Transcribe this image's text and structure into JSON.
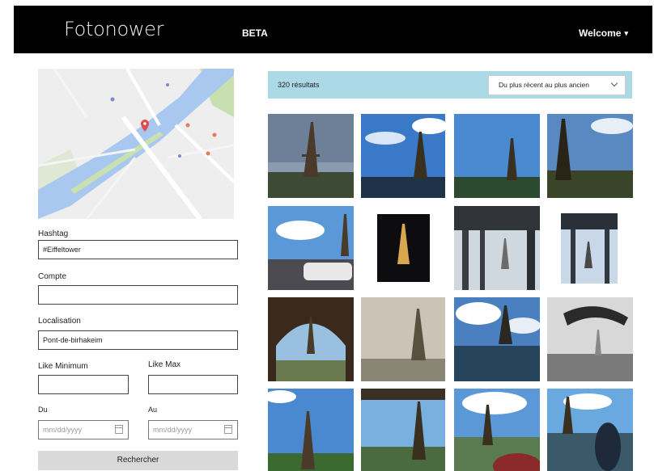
{
  "header": {
    "logo": "Fotonower",
    "beta": "BETA",
    "welcome": "Welcome",
    "welcome_caret": "▾"
  },
  "search": {
    "hashtag_label": "Hashtag",
    "hashtag_value": "#Eiffeltower",
    "compte_label": "Compte",
    "compte_value": "",
    "localisation_label": "Localisation",
    "localisation_value": "Pont-de-birhakeim",
    "like_min_label": "Like Minimum",
    "like_max_label": "Like Max",
    "like_min_value": "",
    "like_max_value": "",
    "du_label": "Du",
    "au_label": "Au",
    "date_placeholder": "mm/dd/yyyy",
    "submit": "Rechercher"
  },
  "results": {
    "count": "320 résultats",
    "sort_selected": "Du plus récent au plus ancien"
  },
  "colors": {
    "topbar": "#000000",
    "results_bar": "#acd9e6",
    "button": "#d9d9d9",
    "map_water": "#a8c8f0",
    "map_land": "#eeeeee",
    "map_pin": "#e24b4b"
  }
}
